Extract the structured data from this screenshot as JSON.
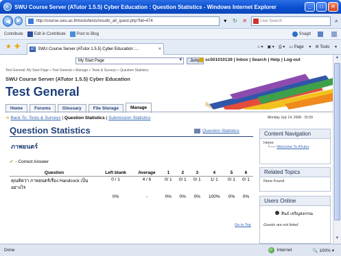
{
  "window": {
    "title": "SWU Course Server (ATutor 1.5.5) Cyber Education : Question Statistics - Windows Internet Explorer"
  },
  "address": {
    "url": "http://course.swu.ac.th/tools/tests/results_all_quest.php?tid=474",
    "search_placeholder": "Live Search"
  },
  "links": {
    "contribute": "Contribute",
    "edit": "Edit in Contribute",
    "post": "Post to Blog",
    "snagit": "SnagIt"
  },
  "tabs": {
    "active_tab": "SWU Course Server (ATutor 1.5.5) Cyber Education :...",
    "page_menu": "Page",
    "tools_menu": "Tools"
  },
  "page": {
    "jump_select": "My Start Page",
    "jump_button": "Jump",
    "user_links": "sc501010139 | Inbox | Search | Help | Log-out",
    "breadcrumbs": "Test General: My Start Page » Test General » Manage » Tests & Surveys » Question Statistics",
    "site_name": "SWU Course Server (ATutor 1.5.5) Cyber Education",
    "course_title": "Test General",
    "nav_tabs": [
      "Home",
      "Forums",
      "Glossary",
      "File Storage",
      "Manage"
    ],
    "subnav": {
      "back": "Back To: Tests & Surveys",
      "current": "Question Statistics",
      "sep": "|",
      "other": "Submission Statistics"
    },
    "date": "Monday July 14, 2008 - 15:59",
    "heading": "Question Statistics",
    "qs_link": "Question Statistics",
    "test_title": "ภาพยนตร์",
    "correct_label": "- Correct Answer",
    "table": {
      "headers": [
        "Question",
        "Left blank",
        "Average",
        "1",
        "2",
        "3",
        "4",
        "5",
        "6"
      ],
      "rows": [
        {
          "question": "คุณคิดว่า ภาพยนตร์เรื่อง Handcock เป็นอย่างไร",
          "left_blank": "0 / 1",
          "average": "4 / 6",
          "c1": "0/ 1",
          "c2": "0/ 1",
          "c3": "0/ 1",
          "c4": "1/ 1",
          "c5": "0/ 1",
          "c6": "0/ 1"
        }
      ],
      "pct_row": {
        "left_blank": "0%",
        "average": "-",
        "c1": "0%",
        "c2": "0%",
        "c3": "0%",
        "c4": "100%",
        "c5": "0%",
        "c6": "0%"
      }
    },
    "go_top": "Go to Top"
  },
  "sidebar": {
    "content_nav": {
      "title": "Content Navigation",
      "home": "Home",
      "welcome": "Welcome To ATutor"
    },
    "related": {
      "title": "Related Topics",
      "none": "None Found"
    },
    "online": {
      "title": "Users Online",
      "user": "สินธ์ เจริญสงกรณ",
      "note": "Guests are not listed"
    }
  },
  "status": {
    "text": "Done",
    "zone": "Internet",
    "zoom": "100%"
  }
}
